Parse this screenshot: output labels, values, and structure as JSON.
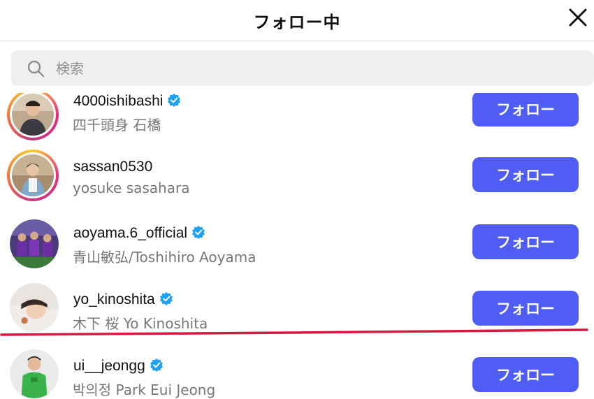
{
  "header": {
    "title": "フォロー中",
    "close_icon": "close-icon"
  },
  "search": {
    "placeholder": "検索",
    "value": "",
    "icon": "search-icon"
  },
  "accent_color": "#4f5df4",
  "verified_color": "#1da1f2",
  "annotation_color": "#d6193f",
  "users": [
    {
      "username": "4000ishibashi",
      "fullname": "四千頭身 石橋",
      "verified": true,
      "story_ring": true,
      "button": "フォロー"
    },
    {
      "username": "sassan0530",
      "fullname": "yosuke sasahara",
      "verified": false,
      "story_ring": true,
      "button": "フォロー"
    },
    {
      "username": "aoyama.6_official",
      "fullname": "青山敏弘/Toshihiro Aoyama",
      "verified": true,
      "story_ring": false,
      "button": "フォロー"
    },
    {
      "username": "yo_kinoshita",
      "fullname": "木下 桜 Yo Kinoshita",
      "verified": true,
      "story_ring": false,
      "button": "フォロー"
    },
    {
      "username": "ui__jeongg",
      "fullname": "박의정 Park Eui Jeong",
      "verified": true,
      "story_ring": false,
      "button": "フォロー"
    }
  ]
}
